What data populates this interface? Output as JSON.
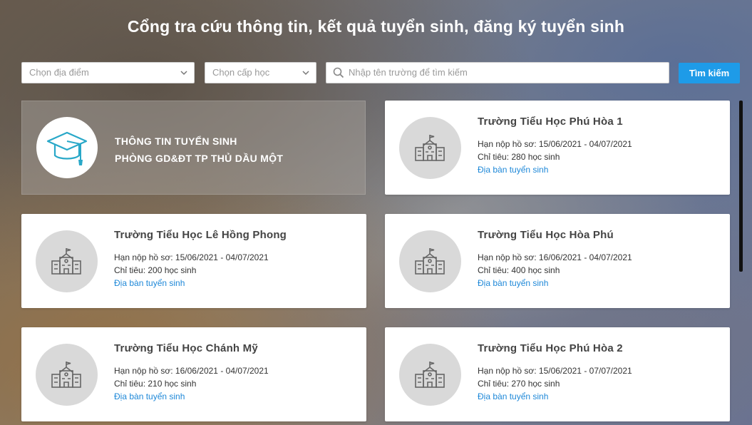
{
  "header": {
    "title": "Cổng tra cứu thông tin, kết quả tuyển sinh, đăng ký tuyển sinh"
  },
  "filters": {
    "location_placeholder": "Chọn địa điểm",
    "level_placeholder": "Chọn cấp học",
    "search_placeholder": "Nhập tên trường để tìm kiếm",
    "search_button": "Tìm kiếm"
  },
  "banner": {
    "line1": "THÔNG TIN TUYỂN SINH",
    "line2": "PHÒNG GD&ĐT TP THỦ DẦU MỘT",
    "icon": "graduation-cap-icon"
  },
  "schools": [
    {
      "name": "Trường Tiểu Học Phú Hòa 1",
      "deadline": "Hạn nộp hồ sơ: 15/06/2021 - 04/07/2021",
      "quota": "Chỉ tiêu: 280 học sinh",
      "link": "Địa bàn tuyển sinh"
    },
    {
      "name": "Trường Tiểu Học Lê Hồng Phong",
      "deadline": "Hạn nộp hồ sơ: 15/06/2021 - 04/07/2021",
      "quota": "Chỉ tiêu: 200 học sinh",
      "link": "Địa bàn tuyển sinh"
    },
    {
      "name": "Trường Tiểu Học Hòa Phú",
      "deadline": "Hạn nộp hồ sơ: 16/06/2021 - 04/07/2021",
      "quota": "Chỉ tiêu: 400 học sinh",
      "link": "Địa bàn tuyển sinh"
    },
    {
      "name": "Trường Tiểu Học Chánh Mỹ",
      "deadline": "Hạn nộp hồ sơ: 16/06/2021 - 04/07/2021",
      "quota": "Chỉ tiêu: 210 học sinh",
      "link": "Địa bàn tuyển sinh"
    },
    {
      "name": "Trường Tiểu Học Phú Hòa 2",
      "deadline": "Hạn nộp hồ sơ: 15/06/2021 - 07/07/2021",
      "quota": "Chỉ tiêu: 270 học sinh",
      "link": "Địa bàn tuyển sinh"
    }
  ],
  "colors": {
    "accent": "#1e9be8",
    "link": "#1e88d8",
    "icon_teal": "#29a8c8"
  }
}
